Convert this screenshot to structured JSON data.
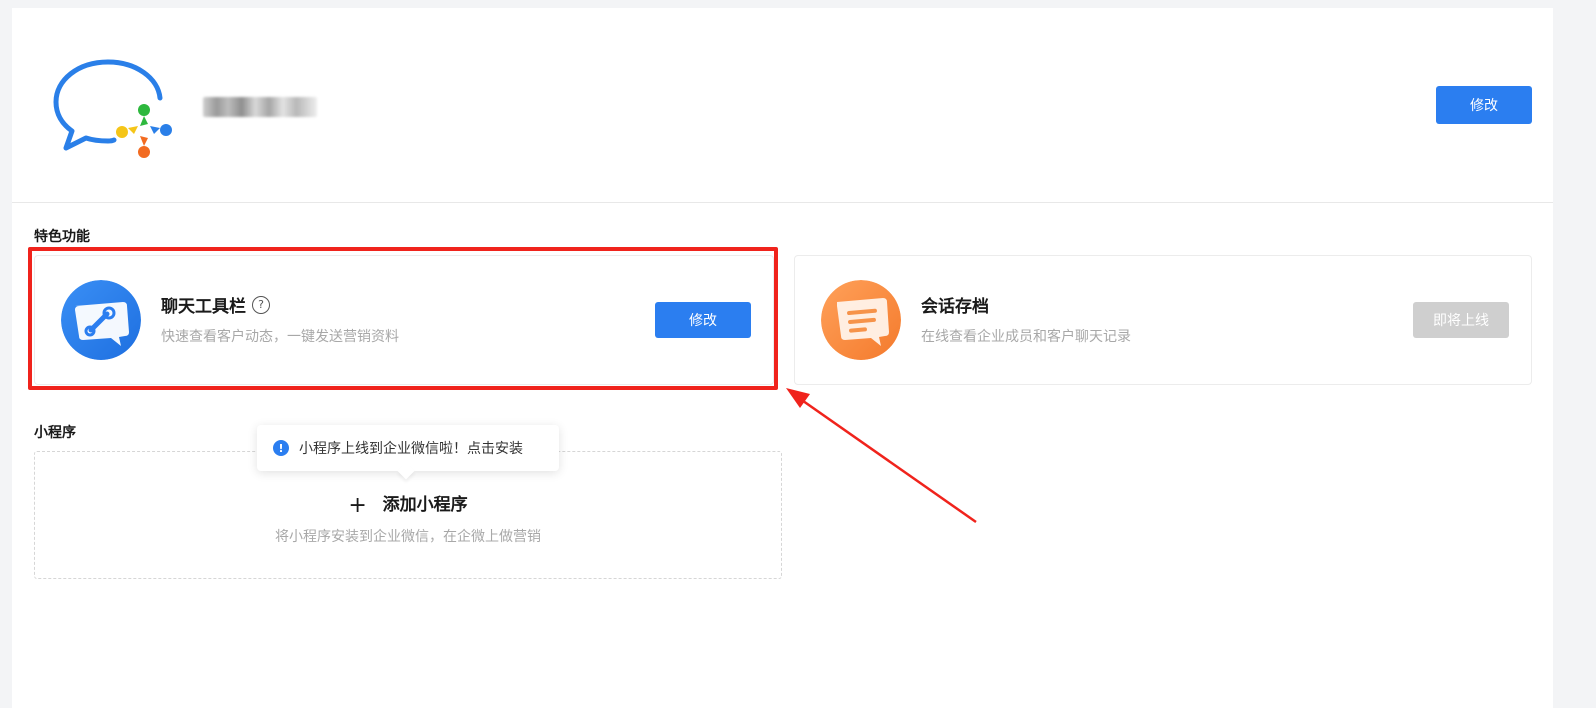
{
  "header": {
    "edit_button": "修改"
  },
  "features": {
    "section_title": "特色功能",
    "chat_toolbar": {
      "title": "聊天工具栏",
      "help": "?",
      "description": "快速查看客户动态，一键发送营销资料",
      "button": "修改"
    },
    "session_archive": {
      "title": "会话存档",
      "description": "在线查看企业成员和客户聊天记录",
      "button": "即将上线"
    }
  },
  "mini_program": {
    "section_title": "小程序",
    "tooltip": "小程序上线到企业微信啦！点击安装",
    "tooltip_icon": "!",
    "add_plus": "+",
    "add_label": "添加小程序",
    "add_description": "将小程序安装到企业微信，在企微上做营销"
  },
  "colors": {
    "primary": "#2b7ef0",
    "highlight": "#f0231c",
    "disabled": "#cfcfcf"
  }
}
